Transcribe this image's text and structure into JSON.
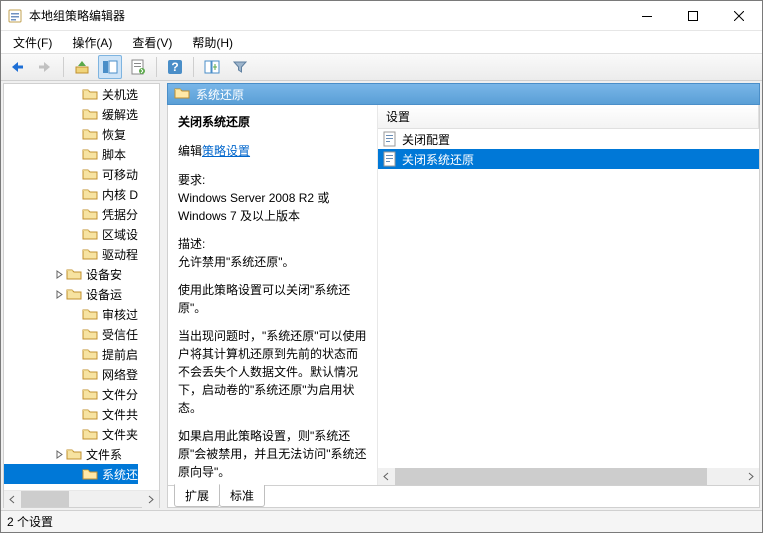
{
  "title": "本地组策略编辑器",
  "menus": [
    "文件(F)",
    "操作(A)",
    "查看(V)",
    "帮助(H)"
  ],
  "tree": {
    "items": [
      {
        "label": "关机选",
        "lvl": 1
      },
      {
        "label": "缓解选",
        "lvl": 1
      },
      {
        "label": "恢复",
        "lvl": 1
      },
      {
        "label": "脚本",
        "lvl": 1
      },
      {
        "label": "可移动",
        "lvl": 1
      },
      {
        "label": "内核 D",
        "lvl": 1
      },
      {
        "label": "凭据分",
        "lvl": 1
      },
      {
        "label": "区域设",
        "lvl": 1
      },
      {
        "label": "驱动程",
        "lvl": 1
      },
      {
        "label": "设备安",
        "lvl": 0,
        "exp": true
      },
      {
        "label": "设备运",
        "lvl": 0,
        "exp": true
      },
      {
        "label": "审核过",
        "lvl": 1
      },
      {
        "label": "受信任",
        "lvl": 1
      },
      {
        "label": "提前启",
        "lvl": 1
      },
      {
        "label": "网络登",
        "lvl": 1
      },
      {
        "label": "文件分",
        "lvl": 1
      },
      {
        "label": "文件共",
        "lvl": 1
      },
      {
        "label": "文件夹",
        "lvl": 1
      },
      {
        "label": "文件系",
        "lvl": 0,
        "exp": true
      },
      {
        "label": "系统还",
        "lvl": 1,
        "sel": true
      }
    ]
  },
  "header_title": "系统还原",
  "policy_title": "关闭系统还原",
  "edit_prefix": "编辑",
  "edit_link": "策略设置",
  "req_label": "要求:",
  "req_text": "Windows Server 2008 R2 或 Windows 7 及以上版本",
  "desc_label": "描述:",
  "desc_p": [
    "允许禁用\"系统还原\"。",
    "使用此策略设置可以关闭\"系统还原\"。",
    "当出现问题时，\"系统还原\"可以使用户将其计算机还原到先前的状态而不会丢失个人数据文件。默认情况下，启动卷的\"系统还原\"为启用状态。",
    "如果启用此策略设置，则\"系统还原\"会被禁用，并且无法访问\"系统还原向导\"。"
  ],
  "col_header": "设置",
  "list": [
    {
      "label": "关闭配置",
      "icon": "policy"
    },
    {
      "label": "关闭系统还原",
      "icon": "policy",
      "sel": true
    }
  ],
  "tabs": [
    "扩展",
    "标准"
  ],
  "status": "2 个设置"
}
